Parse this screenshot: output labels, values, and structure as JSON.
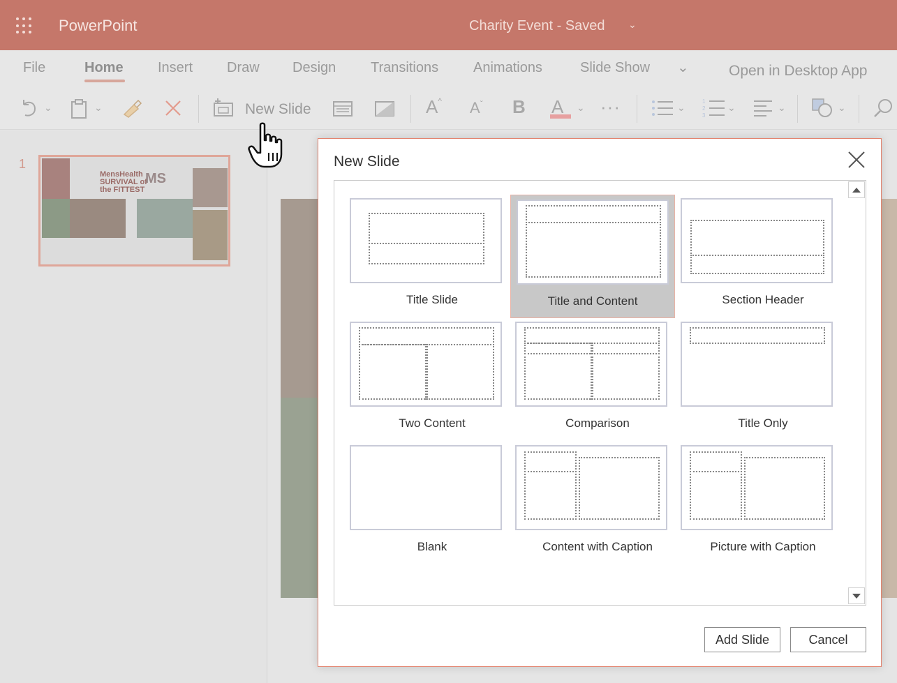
{
  "app": {
    "name": "PowerPoint",
    "document_title": "Charity Event  -  Saved"
  },
  "ribbon": {
    "tabs": [
      "File",
      "Home",
      "Insert",
      "Draw",
      "Design",
      "Transitions",
      "Animations",
      "Slide Show"
    ],
    "active_tab": "Home",
    "open_desktop": "Open in Desktop App",
    "new_slide_label": "New Slide"
  },
  "thumbnails": {
    "slide_number": "1",
    "logo_text_1": "MensHealth SURVIVAL of the FITTEST",
    "logo_text_2": "MS"
  },
  "dialog": {
    "title": "New Slide",
    "layouts": [
      {
        "label": "Title Slide",
        "selected": false
      },
      {
        "label": "Title and Content",
        "selected": true
      },
      {
        "label": "Section Header",
        "selected": false
      },
      {
        "label": "Two Content",
        "selected": false
      },
      {
        "label": "Comparison",
        "selected": false
      },
      {
        "label": "Title Only",
        "selected": false
      },
      {
        "label": "Blank",
        "selected": false
      },
      {
        "label": "Content with Caption",
        "selected": false
      },
      {
        "label": "Picture with Caption",
        "selected": false
      }
    ],
    "add_button": "Add Slide",
    "cancel_button": "Cancel"
  },
  "colors": {
    "titlebar": "#c5776a",
    "accent": "#e2826d"
  }
}
